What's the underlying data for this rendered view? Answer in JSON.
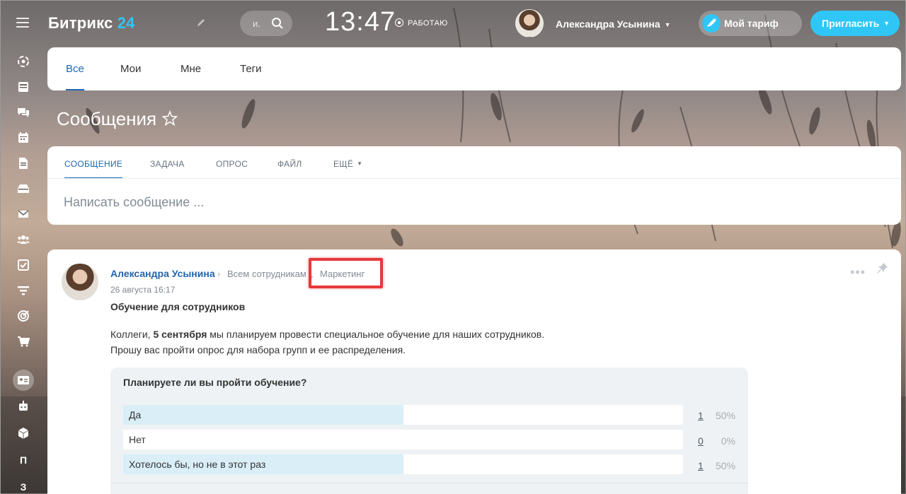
{
  "header": {
    "logo_text": "Битрикс",
    "logo_num": "24",
    "search_placeholder": "и.",
    "clock": "13:47",
    "status": "РАБОТАЮ",
    "user_name": "Александра Усынина",
    "tariff_label": "Мой тариф",
    "invite_label": "Пригласить"
  },
  "sidebar": {
    "items": [
      {
        "icon": "activity-icon"
      },
      {
        "icon": "feed-icon"
      },
      {
        "icon": "chat-icon"
      },
      {
        "icon": "calendar-icon"
      },
      {
        "icon": "document-icon"
      },
      {
        "icon": "drive-icon"
      },
      {
        "icon": "mail-icon"
      },
      {
        "icon": "group-icon"
      },
      {
        "icon": "tasks-icon"
      },
      {
        "icon": "filter-icon"
      },
      {
        "icon": "target-icon"
      },
      {
        "icon": "cart-icon"
      },
      {
        "icon": "contact-card-icon"
      },
      {
        "icon": "robot-icon"
      },
      {
        "icon": "box-icon"
      }
    ],
    "letter_p": "П",
    "letter_z": "З"
  },
  "top_tabs": [
    "Все",
    "Мои",
    "Мне",
    "Теги"
  ],
  "page": {
    "title": "Сообщения"
  },
  "composer": {
    "tabs": [
      "СООБЩЕНИЕ",
      "ЗАДАЧА",
      "ОПРОС",
      "ФАЙЛ",
      "ЕЩЁ"
    ],
    "placeholder": "Написать сообщение ..."
  },
  "post": {
    "author": "Александра Усынина",
    "destination_1": "Всем сотрудникам",
    "destination_sep": ",",
    "destination_2": "Маркетинг",
    "date": "26 августа 16:17",
    "title": "Обучение для сотрудников",
    "body_prefix": "Коллеги, ",
    "body_bold": "5 сентября",
    "body_suffix": " мы планируем провести специальное обучение для наших сотрудников.",
    "body_line2": "Прошу вас пройти опрос для набора групп и ее распределения.",
    "more_label": "•••"
  },
  "poll": {
    "question": "Планируете ли вы пройти обучение?",
    "options": [
      {
        "label": "Да",
        "count": "1",
        "percent": "50%",
        "fraction": 0.5
      },
      {
        "label": "Нет",
        "count": "0",
        "percent": "0%",
        "fraction": 0
      },
      {
        "label": "Хотелось бы, но не в этот раз",
        "count": "1",
        "percent": "50%",
        "fraction": 0.5
      }
    ]
  },
  "colors": {
    "accent": "#2fc6f6",
    "link": "#2066b0",
    "highlight": "#e5393b",
    "poll_fill": "#d9eef7"
  }
}
